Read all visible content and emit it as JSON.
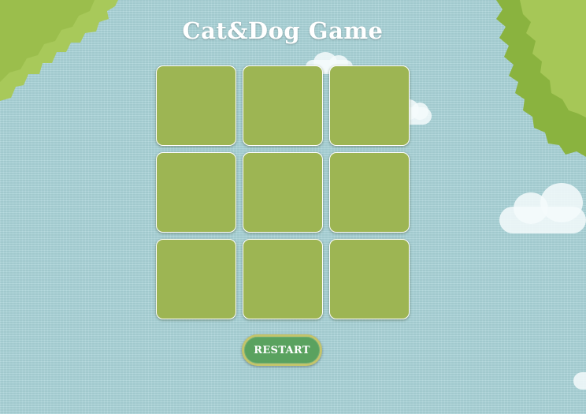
{
  "game": {
    "title": "Cat&Dog Game",
    "board": {
      "rows": 3,
      "columns": 3,
      "cells": [
        "",
        "",
        "",
        "",
        "",
        "",
        "",
        "",
        ""
      ]
    },
    "restart_label": "RESTART"
  },
  "theme": {
    "background": "#a9d3d8",
    "cell_color": "#9db553",
    "cell_border": "#ffffff",
    "button_color": "#5aa25f",
    "button_border": "#c3c46b",
    "title_color": "#ffffff",
    "foliage_light": "#a8c95a",
    "foliage_dark": "#8ab33f"
  },
  "decorations": {
    "top_left": "tree-foliage-icon",
    "top_right": "tree-foliage-icon",
    "clouds": "cloud-icon"
  }
}
